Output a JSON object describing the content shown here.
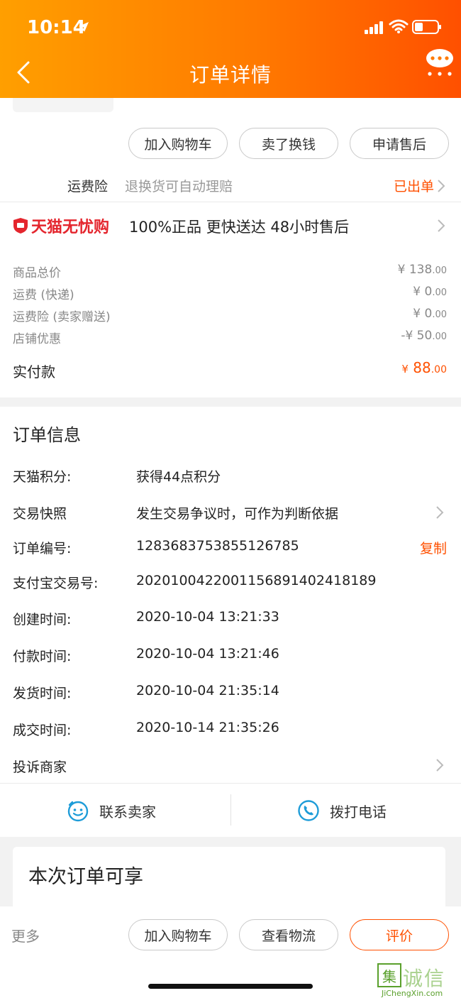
{
  "status_bar": {
    "time": "10:14"
  },
  "header": {
    "title": "订单详情"
  },
  "action_buttons": [
    "加入购物车",
    "卖了换钱",
    "申请售后"
  ],
  "insurance": {
    "label": "运费险",
    "desc": "退换货可自动理赔",
    "status": "已出单"
  },
  "tmall": {
    "brand": "天猫无忧购",
    "tags": "100%正品  更快送达  48小时售后"
  },
  "prices": [
    {
      "label": "商品总价",
      "value": "¥ 138",
      "decimal": ".00"
    },
    {
      "label": "运费 (快递)",
      "value": "¥ 0",
      "decimal": ".00"
    },
    {
      "label": "运费险 (卖家赠送)",
      "value": "¥ 0",
      "decimal": ".00"
    },
    {
      "label": "店铺优惠",
      "value": "-¥ 50",
      "decimal": ".00"
    }
  ],
  "paid": {
    "label": "实付款",
    "currency": "¥",
    "value": "88",
    "decimal": ".00"
  },
  "order_info": {
    "title": "订单信息",
    "rows": [
      {
        "label": "天猫积分:",
        "value": "获得44点积分"
      },
      {
        "label": "交易快照",
        "value": "发生交易争议时，可作为判断依据"
      },
      {
        "label": "订单编号:",
        "value": "1283683753855126785"
      },
      {
        "label": "支付宝交易号:",
        "value": "2020100422001156891402418189"
      },
      {
        "label": "创建时间:",
        "value": "2020-10-04 13:21:33"
      },
      {
        "label": "付款时间:",
        "value": "2020-10-04 13:21:46"
      },
      {
        "label": "发货时间:",
        "value": "2020-10-04 21:35:14"
      },
      {
        "label": "成交时间:",
        "value": "2020-10-14 21:35:26"
      },
      {
        "label": "投诉商家",
        "value": ""
      }
    ],
    "copy_label": "复制"
  },
  "contact": {
    "seller": "联系卖家",
    "phone": "拨打电话"
  },
  "benefits": {
    "title": "本次订单可享"
  },
  "bottom_bar": {
    "more": "更多",
    "buttons": [
      "加入购物车",
      "查看物流",
      "评价"
    ]
  },
  "watermark": {
    "text": "诚信",
    "logo": "集",
    "url": "JiChengXin.com"
  },
  "colors": {
    "accent": "#ff5000",
    "header_start": "#ff9f00",
    "header_end": "#ff5000",
    "tmall_red": "#e4252d"
  }
}
